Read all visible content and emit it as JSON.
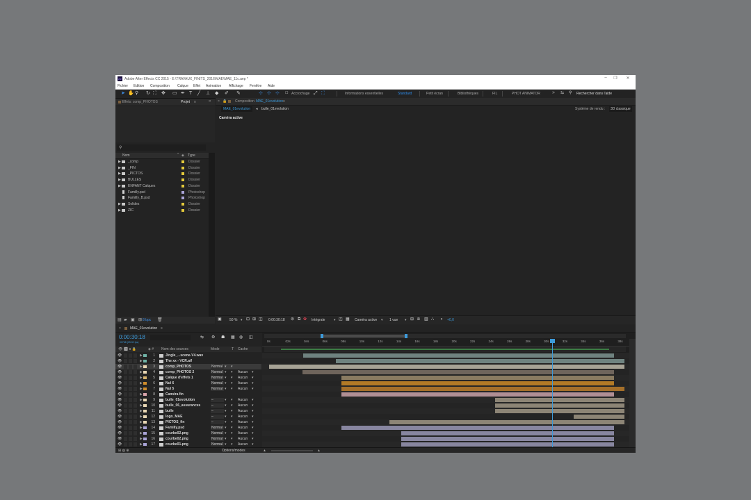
{
  "app": {
    "title": "Adobe After Effects CC 2015 - E:\\TRAVAUX_FINITS_2016\\MAE\\MAE_11c.aep *",
    "logo": "Ae",
    "window_controls": [
      "–",
      "❐",
      "✕"
    ]
  },
  "menu": [
    "Fichier",
    "Edition",
    "Composition",
    "Calque",
    "Effet",
    "Animation",
    "Affichage",
    "Fenêtre",
    "Aide"
  ],
  "toolbar": {
    "tools": [
      "selection-tool-icon",
      "hand-tool-icon",
      "zoom-tool-icon",
      "rotate-tool-icon",
      "camera-tool-icon",
      "pan-behind-tool-icon",
      "rectangle-tool-icon",
      "pen-tool-icon",
      "text-tool-icon",
      "brush-tool-icon",
      "clone-stamp-tool-icon",
      "eraser-tool-icon",
      "roto-brush-tool-icon",
      "puppet-pin-tool-icon"
    ],
    "snap_label": "Accrochage",
    "workspaces": [
      "Informations essentielles",
      "Standard",
      "Petit écran",
      "Bibliothèques",
      "FIL",
      "PHOT ANIMATOR"
    ],
    "active_workspace": "Standard",
    "more": "»",
    "help_placeholder": "Rechercher dans l'aide"
  },
  "project_panel": {
    "tab_effects": "Effets: comp_PHOTOS",
    "tab_project": "Projet",
    "menu_glyph": "≡",
    "search_glyph": "⚲",
    "col_name": "Nom",
    "col_type": "Type",
    "items": [
      {
        "name": "_comp",
        "type": "Dossier",
        "kind": "folder",
        "label_color": "#e3c93b"
      },
      {
        "name": "_FIN",
        "type": "Dossier",
        "kind": "folder",
        "label_color": "#e3c93b"
      },
      {
        "name": "_PICTOS",
        "type": "Dossier",
        "kind": "folder",
        "label_color": "#e3c93b"
      },
      {
        "name": "BULLES",
        "type": "Dossier",
        "kind": "folder",
        "label_color": "#e3c93b"
      },
      {
        "name": "ENFANT Calques",
        "type": "Dossier",
        "kind": "folder",
        "label_color": "#e3c93b"
      },
      {
        "name": "Familly.psd",
        "type": "Photoshop",
        "kind": "file",
        "label_color": "#a9a3d6"
      },
      {
        "name": "Familly_B.psd",
        "type": "Photoshop",
        "kind": "file",
        "label_color": "#a9a3d6"
      },
      {
        "name": "Solides",
        "type": "Dossier",
        "kind": "folder",
        "label_color": "#e3c93b"
      },
      {
        "name": "ZIC",
        "type": "Dossier",
        "kind": "folder",
        "label_color": "#e3c93b"
      }
    ],
    "bpc": "8 bpc"
  },
  "composition_panel": {
    "tab_label": "Composition",
    "comp_name": "MAE_01evolution",
    "breadcrumb_active": "MAE_01evolution",
    "breadcrumb_next": "bulle_01evolution",
    "renderer_label": "Système de rendu :",
    "renderer_value": "3D classique",
    "camera_label": "Caméra active",
    "zoom": "50 %",
    "timecode": "0:00:30:18",
    "resolution": "Intégrale",
    "camera_select": "Caméra active",
    "views": "1 vue",
    "exposure": "+0,0"
  },
  "timeline": {
    "tab": "MAE_01evolution",
    "timecode": "0:00:30:18",
    "fps": "00768 (25.00 fps)",
    "col_source": "Nom des sources",
    "col_mode": "Mode",
    "col_t": "T",
    "col_cache": "Cache",
    "ruler": [
      "0s",
      "01s",
      "02s",
      "03s",
      "04s",
      "05s",
      "06s",
      "07s",
      "08s",
      "09s",
      "10s",
      "11s",
      "12s",
      "13s",
      "14s",
      "15s",
      "16s",
      "17s",
      "18s",
      "19s",
      "20s",
      "21s",
      "22s",
      "23s",
      "24s",
      "25s",
      "26s",
      "27s",
      "28s",
      "29s",
      "30s",
      "31s",
      "32s",
      "33s",
      "34s",
      "35s",
      "36s",
      "37s",
      "38s"
    ],
    "playhead": 30.7,
    "duration": 38.5,
    "layers": [
      {
        "num": "1",
        "name": "Jingle_...scene-V4.wav",
        "label_color": "#6fb3a6",
        "mode": "",
        "cache": "",
        "bar": [
          3.7,
          37.4
        ],
        "bar_color": "#6f8380",
        "selected": false
      },
      {
        "num": "2",
        "name": "The xx - VCR.aif",
        "label_color": "#6fb3a6",
        "mode": "",
        "cache": "",
        "bar": [
          7.2,
          38.5
        ],
        "bar_color": "#6f8380",
        "selected": false
      },
      {
        "num": "3",
        "name": "comp_PHOTOS",
        "label_color": "#e8d7b4",
        "mode": "Normal",
        "cache": "",
        "bar": [
          0,
          38.5
        ],
        "bar_color": "#a7a396",
        "selected": true
      },
      {
        "num": "4",
        "name": "comp_PHOTOS 2",
        "label_color": "#e8d7b4",
        "mode": "Normal",
        "cache": "Aucun",
        "bar": [
          3.6,
          37.4
        ],
        "bar_color": "#6f655c",
        "selected": false
      },
      {
        "num": "5",
        "name": "Calque d'effets 1",
        "label_color": "#d7b36e",
        "mode": "Normal",
        "cache": "Aucun",
        "bar": [
          7.8,
          37.4
        ],
        "bar_color": "#8a7b61",
        "selected": false
      },
      {
        "num": "6",
        "name": "Nul 6",
        "label_color": "#cf8c2b",
        "mode": "Normal",
        "cache": "Aucun",
        "bar": [
          7.8,
          37.4
        ],
        "bar_color": "#b27a26",
        "selected": false
      },
      {
        "num": "7",
        "name": "Nul 5",
        "label_color": "#cf8c2b",
        "mode": "Normal",
        "cache": "Aucun",
        "bar": [
          7.8,
          38.5
        ],
        "bar_color": "#a46f2a",
        "selected": false
      },
      {
        "num": "8",
        "name": "Caméra fin",
        "label_color": "#d9a3aa",
        "mode": "",
        "cache": "",
        "bar": [
          7.8,
          37.4
        ],
        "bar_color": "#b08f95",
        "selected": false
      },
      {
        "num": "9",
        "name": "bulle_01evolution",
        "label_color": "#e8d7b4",
        "mode": "–",
        "cache": "Aucun",
        "bar": [
          24.5,
          38.5
        ],
        "bar_color": "#8d8576",
        "selected": false
      },
      {
        "num": "10",
        "name": "bulle_06_assurances",
        "label_color": "#e8d7b4",
        "mode": "–",
        "cache": "Aucun",
        "bar": [
          24.5,
          38.5
        ],
        "bar_color": "#8d8576",
        "selected": false
      },
      {
        "num": "11",
        "name": "bulle",
        "label_color": "#e8d7b4",
        "mode": "–",
        "cache": "Aucun",
        "bar": [
          24.5,
          38.5
        ],
        "bar_color": "#8d8576",
        "selected": false
      },
      {
        "num": "12",
        "name": "logo_MAE",
        "label_color": "#e8d7b4",
        "mode": "–",
        "cache": "Aucun",
        "bar": [
          33.0,
          38.5
        ],
        "bar_color": "#8d8576",
        "selected": false
      },
      {
        "num": "13",
        "name": "PICTOS_fin",
        "label_color": "#e8d7b4",
        "mode": "–",
        "cache": "Aucun",
        "bar": [
          13.0,
          38.5
        ],
        "bar_color": "#8d8576",
        "selected": false
      },
      {
        "num": "14",
        "name": "Familly.psd",
        "label_color": "#a9a3d6",
        "mode": "Normal",
        "cache": "Aucun",
        "bar": [
          7.8,
          37.4
        ],
        "bar_color": "#8886a0",
        "selected": false
      },
      {
        "num": "15",
        "name": "courbe02.png",
        "label_color": "#a9a3d6",
        "mode": "Normal",
        "cache": "Aucun",
        "bar": [
          14.3,
          37.4
        ],
        "bar_color": "#8886a0",
        "selected": false
      },
      {
        "num": "16",
        "name": "courbe02.png",
        "label_color": "#a9a3d6",
        "mode": "Normal",
        "cache": "Aucun",
        "bar": [
          14.3,
          37.4
        ],
        "bar_color": "#8886a0",
        "selected": false
      },
      {
        "num": "17",
        "name": "courbe01.png",
        "label_color": "#a9a3d6",
        "mode": "Normal",
        "cache": "Aucun",
        "bar": [
          14.3,
          37.4
        ],
        "bar_color": "#8886a0",
        "selected": false
      }
    ],
    "options_label": "Options/modes"
  },
  "colors": {
    "accent": "#2d8ceb",
    "panel": "#232323",
    "playhead": "#3d9ad9"
  }
}
